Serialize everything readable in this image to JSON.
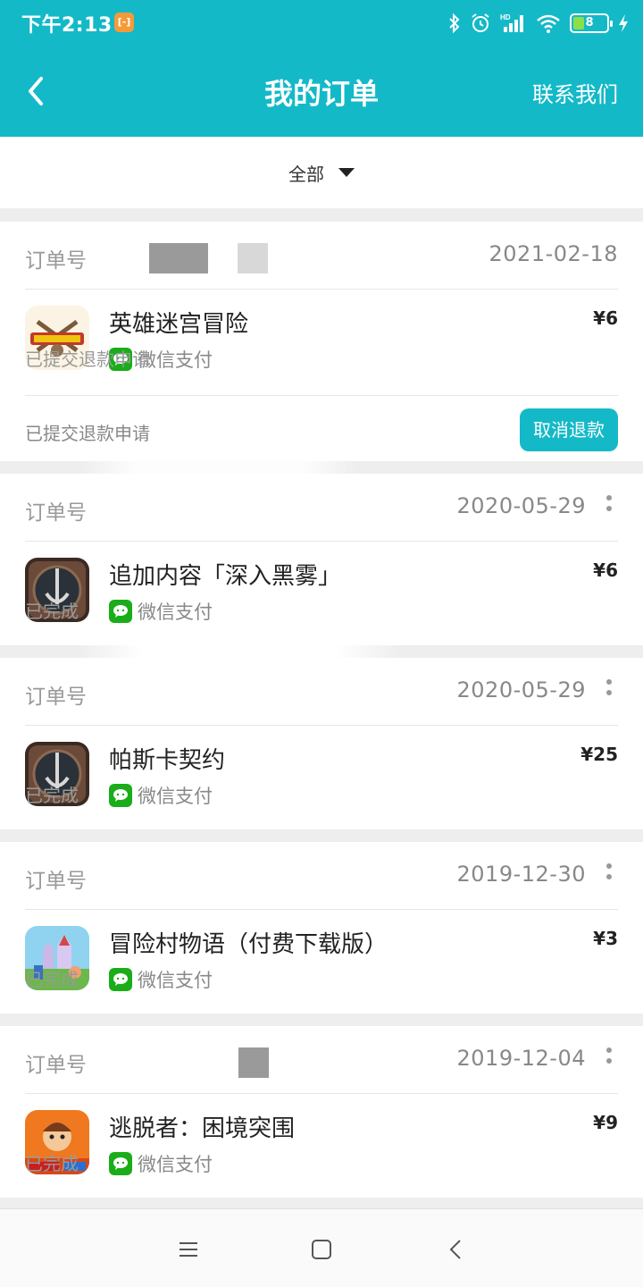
{
  "status_bar": {
    "time": "下午2:13",
    "battery": "8",
    "network_label": "HD"
  },
  "header": {
    "title": "我的订单",
    "contact": "联系我们"
  },
  "filter": {
    "selected": "全部"
  },
  "orders": [
    {
      "order_label": "订单号",
      "date": "2021-02-18",
      "app_name": "英雄迷宫冒险",
      "payment": "微信支付",
      "price": "¥6",
      "status": "已提交退款申请",
      "footer_text": "已提交退款申请",
      "action": "取消退款"
    },
    {
      "order_label": "订单号",
      "date": "2020-05-29",
      "app_name": "追加内容「深入黑雾」",
      "payment": "微信支付",
      "price": "¥6",
      "status": "已完成"
    },
    {
      "order_label": "订单号",
      "date": "2020-05-29",
      "app_name": "帕斯卡契约",
      "payment": "微信支付",
      "price": "¥25",
      "status": "已完成"
    },
    {
      "order_label": "订单号",
      "date": "2019-12-30",
      "app_name": "冒险村物语（付费下载版）",
      "payment": "微信支付",
      "price": "¥3",
      "status": "已完成"
    },
    {
      "order_label": "订单号",
      "date": "2019-12-04",
      "app_name": "逃脱者：困境突围",
      "payment": "微信支付",
      "price": "¥9",
      "status": "已完成"
    }
  ],
  "colors": {
    "accent": "#14b9c8",
    "wechat": "#1aad19"
  }
}
